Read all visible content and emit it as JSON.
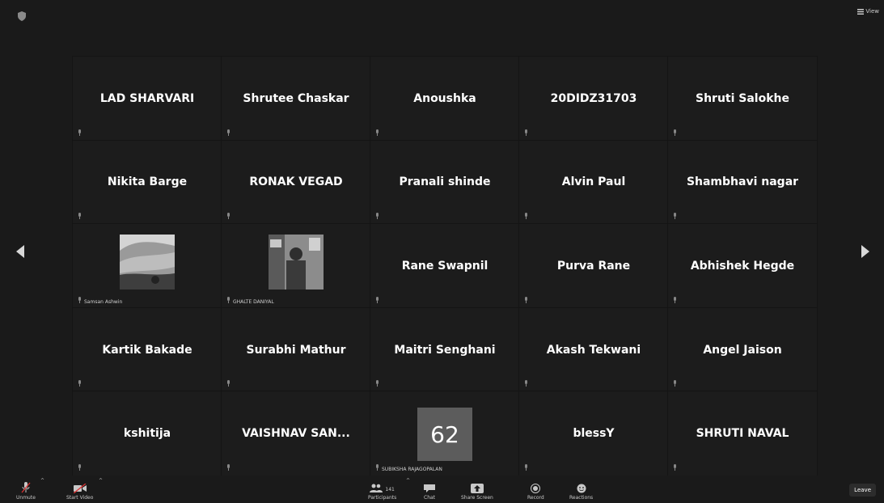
{
  "top_right": {
    "view_label": "View"
  },
  "participants": [
    {
      "name": "LAD SHARVARI"
    },
    {
      "name": "Shrutee Chaskar"
    },
    {
      "name": "Anoushka"
    },
    {
      "name": "20DIDZ31703"
    },
    {
      "name": "Shruti Salokhe"
    },
    {
      "name": "Nikita Barge"
    },
    {
      "name": "RONAK VEGAD"
    },
    {
      "name": "Pranali shinde"
    },
    {
      "name": "Alvin Paul"
    },
    {
      "name": "Shambhavi nagar"
    },
    {
      "label": "Samsan Ashwin",
      "video": true
    },
    {
      "label": "GHALTE DANIYAL",
      "video": true
    },
    {
      "name": "Rane Swapnil"
    },
    {
      "name": "Purva Rane"
    },
    {
      "name": "Abhishek Hegde"
    },
    {
      "name": "Kartik Bakade"
    },
    {
      "name": "Surabhi Mathur"
    },
    {
      "name": "Maitri Senghani"
    },
    {
      "name": "Akash Tekwani"
    },
    {
      "name": "Angel Jaison"
    },
    {
      "name": "kshitija"
    },
    {
      "name": "VAISHNAV SAN..."
    },
    {
      "badge": "62",
      "label": "SUBIKSHA RAJAGOPALAN"
    },
    {
      "name": "blessY"
    },
    {
      "name": "SHRUTI NAVAL"
    }
  ],
  "toolbar": {
    "unmute_label": "Unmute",
    "start_video_label": "Start Video",
    "participants_label": "Participants",
    "participants_count": "141",
    "chat_label": "Chat",
    "share_screen_label": "Share Screen",
    "record_label": "Record",
    "reactions_label": "Reactions",
    "leave_label": "Leave"
  }
}
